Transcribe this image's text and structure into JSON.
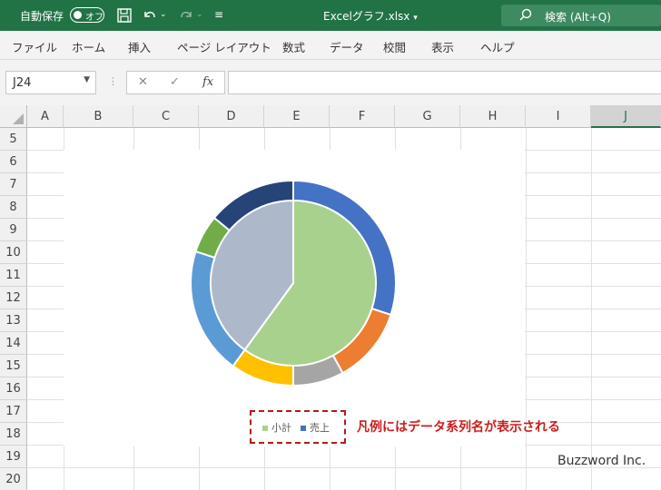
{
  "titlebar": {
    "autosave_label": "自動保存",
    "toggle_label": "オフ",
    "filename": "Excelグラフ.xlsx",
    "search_placeholder": "検索 (Alt+Q)"
  },
  "menu": {
    "items": [
      "ファイル",
      "ホーム",
      "挿入",
      "ページ レイアウト",
      "数式",
      "データ",
      "校閲",
      "表示",
      "ヘルプ"
    ]
  },
  "formula": {
    "name_box": "J24",
    "fx_label": "fx"
  },
  "grid": {
    "columns": [
      "A",
      "B",
      "C",
      "D",
      "E",
      "F",
      "G",
      "H",
      "I",
      "J"
    ],
    "selected_column": "J",
    "rows": [
      "5",
      "6",
      "7",
      "8",
      "9",
      "10",
      "11",
      "12",
      "13",
      "14",
      "15",
      "16",
      "17",
      "18",
      "19",
      "20"
    ]
  },
  "chart_data": {
    "type": "doughnut-pie",
    "title": "",
    "series": [
      {
        "name": "小計",
        "kind": "pie",
        "values": [
          60,
          40
        ],
        "colors": [
          "#a9d18e",
          "#adb9ca"
        ]
      },
      {
        "name": "売上",
        "kind": "ring",
        "values": [
          30,
          12,
          8,
          10,
          20,
          6,
          14
        ],
        "colors": [
          "#4472c4",
          "#ed7d31",
          "#a5a5a5",
          "#ffc000",
          "#5b9bd5",
          "#70ad47",
          "#264478"
        ]
      }
    ],
    "legend": {
      "items": [
        {
          "label": "小計",
          "color": "#a9d18e"
        },
        {
          "label": "売上",
          "color": "#4472c4"
        }
      ],
      "position": "bottom"
    }
  },
  "annotation": "凡例にはデータ系列名が表示される",
  "watermark": "Buzzword Inc."
}
